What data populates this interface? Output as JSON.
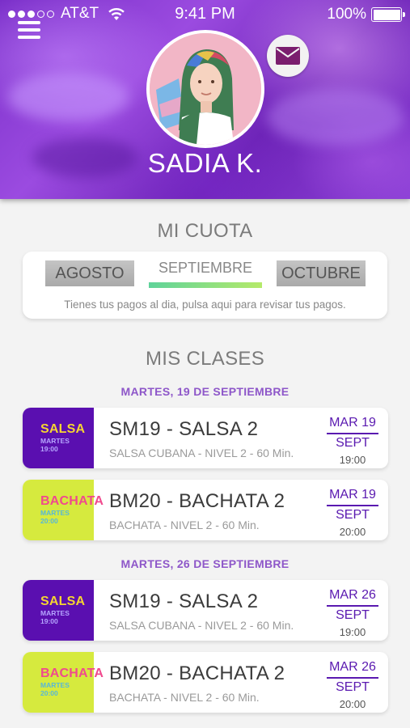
{
  "status_bar": {
    "carrier": "AT&T",
    "time": "9:41 PM",
    "battery": "100%"
  },
  "profile": {
    "name": "SADIA K."
  },
  "cuota": {
    "title": "MI CUOTA",
    "prev_month": "AGOSTO",
    "current_month": "SEPTIEMBRE",
    "next_month": "OCTUBRE",
    "note": "Tienes tus pagos al dia, pulsa aqui para revisar tus pagos."
  },
  "clases": {
    "title": "MIS CLASES",
    "groups": [
      {
        "date_label": "MARTES, 19 DE SEPTIEMBRE",
        "items": [
          {
            "thumb_name": "SALSA",
            "thumb_day": "MARTES",
            "thumb_time": "19:00",
            "style": "salsa",
            "title": "SM19 - SALSA 2",
            "desc": "SALSA CUBANA - NIVEL 2 - 60 Min.",
            "date_day": "MAR 19",
            "date_month": "SEPT",
            "date_time": "19:00"
          },
          {
            "thumb_name": "BACHATA",
            "thumb_day": "MARTES",
            "thumb_time": "20:00",
            "style": "bachata",
            "title": "BM20 - BACHATA 2",
            "desc": "BACHATA - NIVEL 2 - 60 Min.",
            "date_day": "MAR 19",
            "date_month": "SEPT",
            "date_time": "20:00"
          }
        ]
      },
      {
        "date_label": "MARTES, 26 DE SEPTIEMBRE",
        "items": [
          {
            "thumb_name": "SALSA",
            "thumb_day": "MARTES",
            "thumb_time": "19:00",
            "style": "salsa",
            "title": "SM19 - SALSA 2",
            "desc": "SALSA CUBANA - NIVEL 2 - 60 Min.",
            "date_day": "MAR 26",
            "date_month": "SEPT",
            "date_time": "19:00"
          },
          {
            "thumb_name": "BACHATA",
            "thumb_day": "MARTES",
            "thumb_time": "20:00",
            "style": "bachata",
            "title": "BM20 - BACHATA 2",
            "desc": "BACHATA - NIVEL 2 - 60 Min.",
            "date_day": "MAR 26",
            "date_month": "SEPT",
            "date_time": "20:00"
          }
        ]
      }
    ]
  },
  "colors": {
    "accent_purple": "#5a19b0",
    "salsa_bg": "#5a0fb0",
    "bachata_bg": "#d6ea3e",
    "date_heading": "#8e57c9"
  },
  "icons": {
    "menu": "hamburger-menu-icon",
    "mail": "envelope-icon",
    "wifi": "wifi-icon",
    "battery": "battery-icon"
  }
}
